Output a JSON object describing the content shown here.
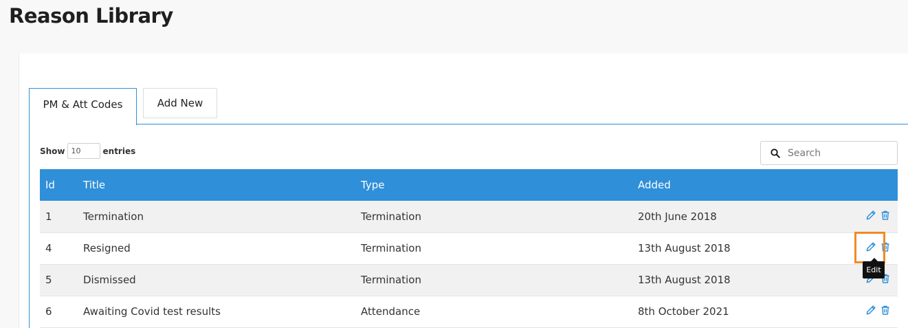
{
  "page": {
    "title": "Reason Library"
  },
  "tabs": [
    {
      "label": "PM & Att Codes",
      "active": true
    },
    {
      "label": "Add New",
      "active": false
    }
  ],
  "table_controls": {
    "show_label": "Show",
    "page_size": "10",
    "entries_label": "entries",
    "search_placeholder": "Search"
  },
  "table": {
    "columns": [
      "Id",
      "Title",
      "Type",
      "Added"
    ],
    "rows": [
      {
        "id": "1",
        "title": "Termination",
        "type": "Termination",
        "added": "20th June 2018"
      },
      {
        "id": "4",
        "title": "Resigned",
        "type": "Termination",
        "added": "13th August 2018"
      },
      {
        "id": "5",
        "title": "Dismissed",
        "type": "Termination",
        "added": "13th August 2018"
      },
      {
        "id": "6",
        "title": "Awaiting Covid test results",
        "type": "Attendance",
        "added": "8th October 2021"
      }
    ]
  },
  "tooltip": {
    "text": "Edit"
  },
  "icons": {
    "edit": "pencil-icon",
    "delete": "trash-icon",
    "search": "search-icon"
  },
  "colors": {
    "accent": "#2f8fd8",
    "highlight": "#f08a24",
    "icon": "#2f8fd8"
  }
}
